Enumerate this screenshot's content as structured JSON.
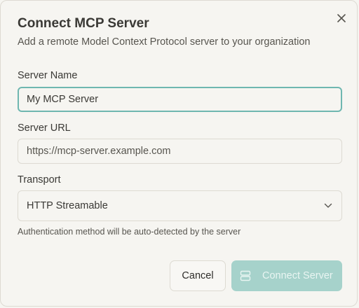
{
  "dialog": {
    "title": "Connect MCP Server",
    "subtitle": "Add a remote Model Context Protocol server to your organization"
  },
  "form": {
    "server_name": {
      "label": "Server Name",
      "value": "My MCP Server"
    },
    "server_url": {
      "label": "Server URL",
      "placeholder": "https://mcp-server.example.com"
    },
    "transport": {
      "label": "Transport",
      "selected": "HTTP Streamable"
    },
    "helper_text": "Authentication method will be auto-detected by the server"
  },
  "actions": {
    "cancel_label": "Cancel",
    "connect_label": "Connect Server"
  },
  "icons": {
    "close": "close-icon",
    "chevron": "chevron-down-icon",
    "server": "server-icon"
  },
  "colors": {
    "accent": "#a6d2cb",
    "focus_ring": "#6fb7b0",
    "background": "#f6f5f1"
  }
}
